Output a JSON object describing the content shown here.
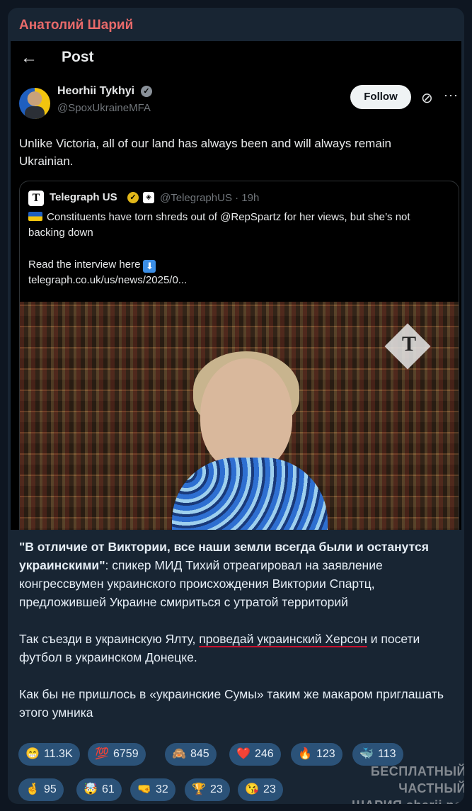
{
  "channel": {
    "title": "Анатолий Шарий"
  },
  "tweet": {
    "header_title": "Post",
    "author_name": "Heorhii Tykhyi",
    "author_handle": "@SpoxUkraineMFA",
    "follow_label": "Follow",
    "text": "Unlike Victoria, all of our land has always been and will always remain Ukrainian.",
    "quote": {
      "name": "Telegraph US",
      "handle_time": "@TelegraphUS · 19h",
      "text": "Constituents have torn shreds out of @RepSpartz for her views, but she’s not backing down",
      "read_label": "Read the interview here",
      "link": "telegraph.co.uk/us/news/2025/0..."
    }
  },
  "post": {
    "p1_bold": "\"В отличие от Виктории, все наши земли всегда были и останутся украинскими\"",
    "p1_rest": ": спикер МИД Тихий  отреагировал на заявление конгрессвумен украинского происхождения Виктории Спартц, предложившей Украине смириться с утратой территорий",
    "p2_pre": "Так съезди в украинскую Ялту, ",
    "p2_underlined": "проведай украинский Херсон",
    "p2_post": " и посети футбол в украинском Донецке.",
    "p3": "Как бы не пришлось в «украинские Сумы» таким же макаром приглашать этого умника"
  },
  "reactions": [
    {
      "emoji": "😁",
      "count": "11.3K"
    },
    {
      "emoji": "💯",
      "count": "6759"
    },
    {
      "emoji": "🙈",
      "count": "845"
    },
    {
      "emoji": "❤️",
      "count": "246"
    },
    {
      "emoji": "🔥",
      "count": "123"
    },
    {
      "emoji": "🐳",
      "count": "113"
    },
    {
      "emoji": "🤞",
      "count": "95"
    },
    {
      "emoji": "🤯",
      "count": "61"
    },
    {
      "emoji": "🤜",
      "count": "32"
    },
    {
      "emoji": "🏆",
      "count": "23"
    },
    {
      "emoji": "😘",
      "count": "23"
    }
  ],
  "watermark": {
    "line1": "БЕСПЛАТНЫЙ ЧАСТНЫЙ",
    "line2": "ШАРИЯ sharij.net"
  },
  "colors": {
    "background": "#0e1621",
    "card": "#182533",
    "channel_name": "#e86a6a",
    "reaction_chip": "#2b5278"
  }
}
